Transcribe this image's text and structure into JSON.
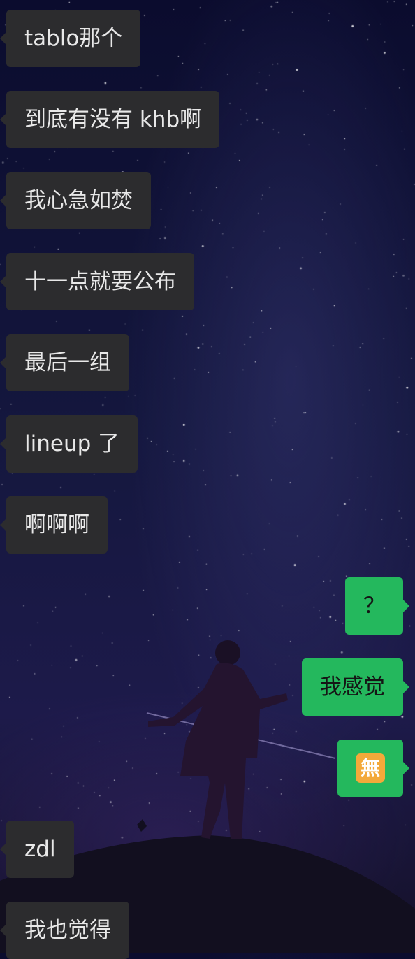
{
  "messages": [
    {
      "side": "incoming",
      "text": "tablo那个"
    },
    {
      "side": "incoming",
      "text": "到底有没有 khb啊"
    },
    {
      "side": "incoming",
      "text": "我心急如焚"
    },
    {
      "side": "incoming",
      "text": "十一点就要公布"
    },
    {
      "side": "incoming",
      "text": "最后一组"
    },
    {
      "side": "incoming",
      "text": "lineup 了"
    },
    {
      "side": "incoming",
      "text": "啊啊啊"
    },
    {
      "side": "outgoing",
      "text": "？"
    },
    {
      "side": "outgoing",
      "text": "我感觉"
    },
    {
      "side": "outgoing",
      "emoji": "japanese-free-of-charge-button-icon",
      "emoji_text": "無"
    },
    {
      "side": "incoming",
      "text": "zdl"
    },
    {
      "side": "incoming",
      "text": "我也觉得"
    }
  ],
  "colors": {
    "incoming_bubble": "#2c2c2e",
    "outgoing_bubble": "#24b85d",
    "emoji_bg": "#f3a93a"
  }
}
